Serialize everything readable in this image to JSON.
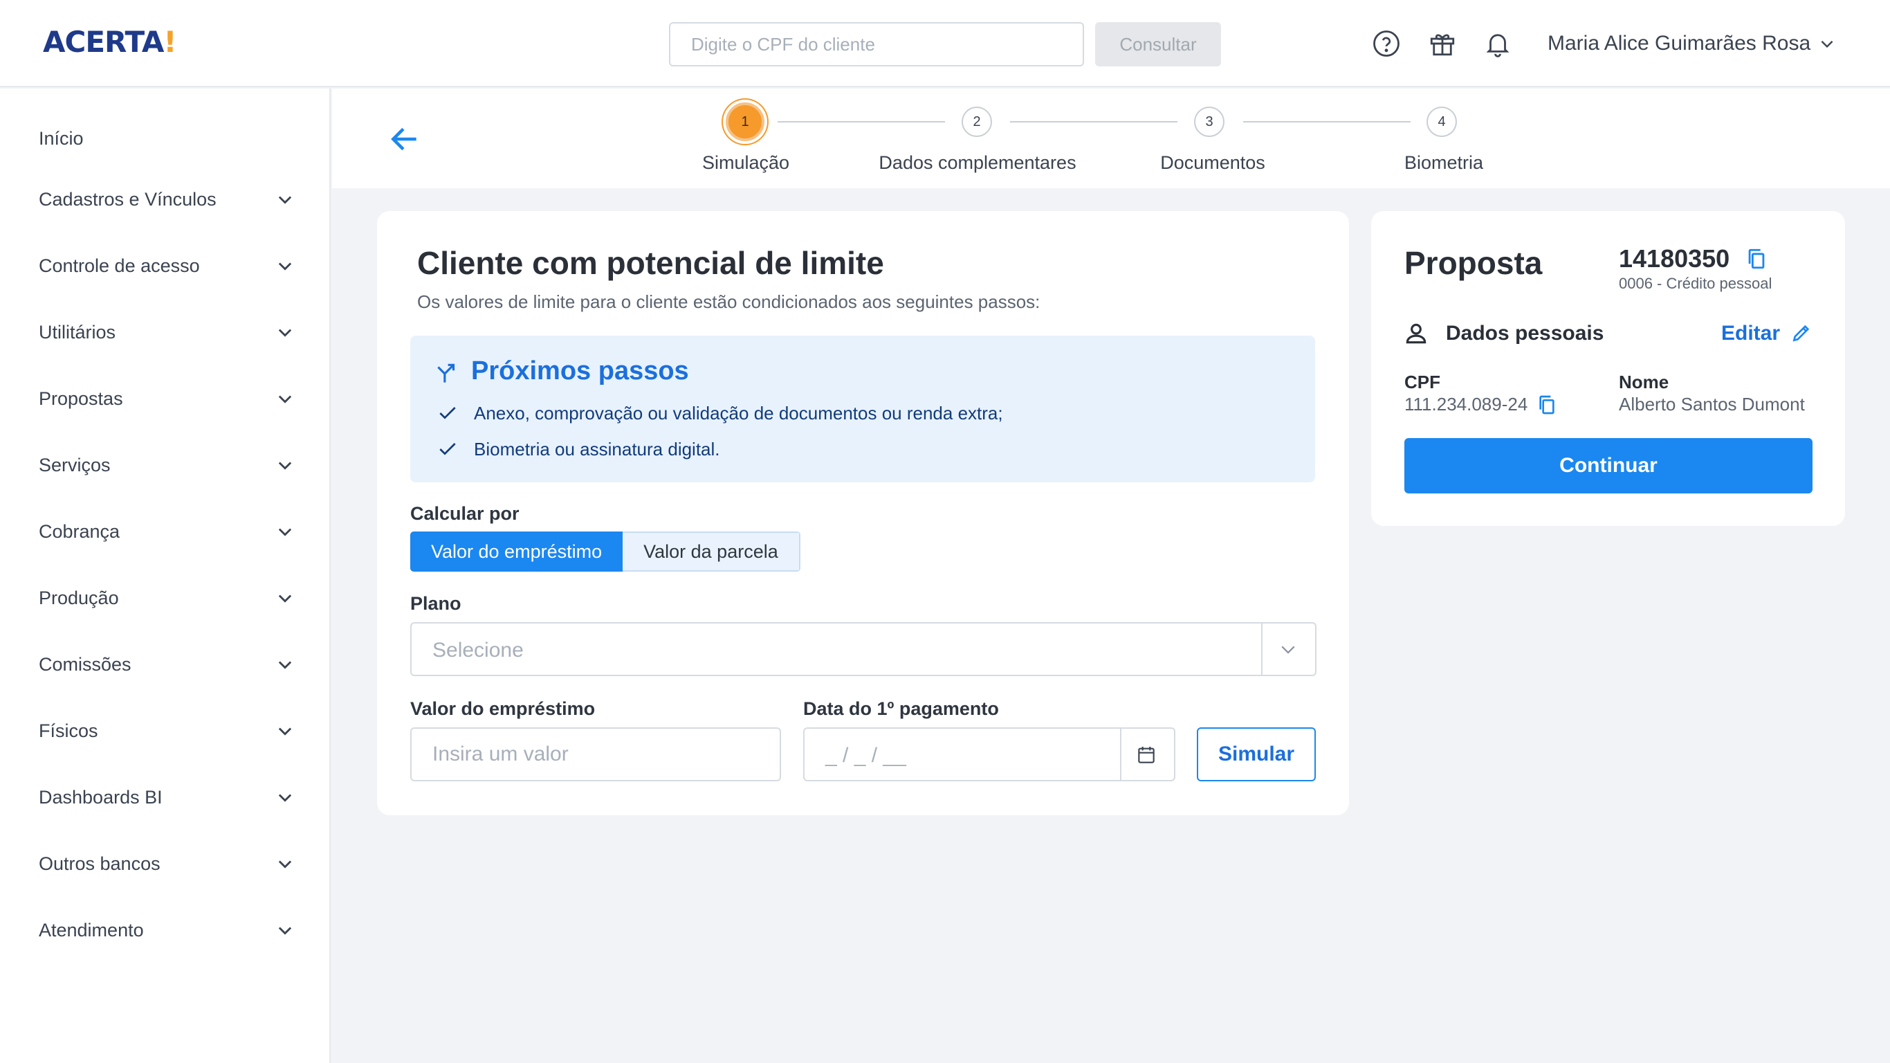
{
  "header": {
    "logo_text": "ACERTA",
    "logo_bang": "!",
    "search_placeholder": "Digite o CPF do cliente",
    "consult_label": "Consultar",
    "user_name": "Maria Alice Guimarães Rosa",
    "icons": [
      "help-icon",
      "gift-icon",
      "bell-icon",
      "chevron-down-icon"
    ]
  },
  "sidebar": {
    "items": [
      {
        "label": "Início",
        "has_chevron": false
      },
      {
        "label": "Cadastros e Vínculos",
        "has_chevron": true
      },
      {
        "label": "Controle de acesso",
        "has_chevron": true
      },
      {
        "label": "Utilitários",
        "has_chevron": true
      },
      {
        "label": "Propostas",
        "has_chevron": true
      },
      {
        "label": "Serviços",
        "has_chevron": true
      },
      {
        "label": "Cobrança",
        "has_chevron": true
      },
      {
        "label": "Produção",
        "has_chevron": true
      },
      {
        "label": "Comissões",
        "has_chevron": true
      },
      {
        "label": "Físicos",
        "has_chevron": true
      },
      {
        "label": "Dashboards BI",
        "has_chevron": true
      },
      {
        "label": "Outros bancos",
        "has_chevron": true
      },
      {
        "label": "Atendimento",
        "has_chevron": true
      }
    ]
  },
  "stepper": {
    "current": 1,
    "steps": [
      {
        "number": "1",
        "label": "Simulação"
      },
      {
        "number": "2",
        "label": "Dados complementares"
      },
      {
        "number": "3",
        "label": "Documentos"
      },
      {
        "number": "4",
        "label": "Biometria"
      }
    ]
  },
  "main": {
    "title": "Cliente com potencial de limite",
    "subtitle": "Os valores de limite para o cliente estão condicionados aos seguintes passos:",
    "next_steps": {
      "title": "Próximos passos",
      "items": [
        "Anexo, comprovação ou validação de documentos ou renda extra;",
        "Biometria ou assinatura digital."
      ]
    },
    "calc_label": "Calcular por",
    "calc_options": [
      "Valor do empréstimo",
      "Valor da parcela"
    ],
    "calc_selected": "Valor do empréstimo",
    "plan_label": "Plano",
    "plan_placeholder": "Selecione",
    "loan_label": "Valor do empréstimo",
    "loan_placeholder": "Insira um valor",
    "date_label": "Data do 1º pagamento",
    "date_placeholder": "_ / _ / __",
    "simulate_label": "Simular"
  },
  "proposal": {
    "title": "Proposta",
    "number": "14180350",
    "type": "0006 - Crédito pessoal",
    "personal_label": "Dados pessoais",
    "edit_label": "Editar",
    "cpf_label": "CPF",
    "cpf_value": "111.234.089-24",
    "name_label": "Nome",
    "name_value": "Alberto Santos Dumont",
    "continue_label": "Continuar"
  },
  "colors": {
    "primary": "#1b87f0",
    "accent": "#f59a2b",
    "info_bg": "#e8f2fd",
    "page_bg": "#f1f3f6"
  }
}
